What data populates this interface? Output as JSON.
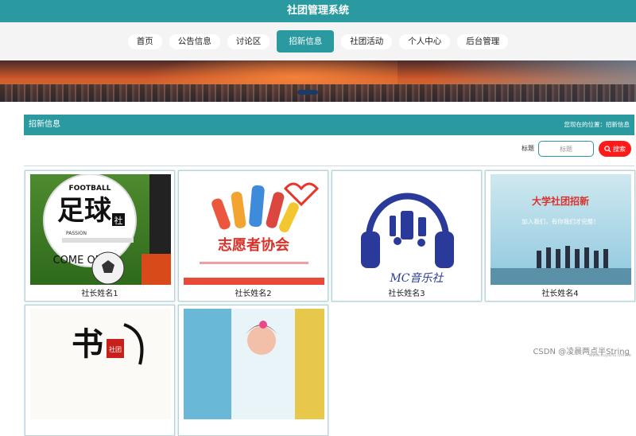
{
  "header": {
    "title": "社团管理系统"
  },
  "nav": {
    "items": [
      {
        "label": "首页"
      },
      {
        "label": "公告信息"
      },
      {
        "label": "讨论区"
      },
      {
        "label": "招新信息"
      },
      {
        "label": "社团活动"
      },
      {
        "label": "个人中心"
      },
      {
        "label": "后台管理"
      }
    ],
    "active_index": 3
  },
  "section": {
    "title": "招新信息",
    "breadcrumb": "您现在的位置：招新信息"
  },
  "search": {
    "label": "标题",
    "placeholder": "标题",
    "button_label": "搜索",
    "icon": "search-icon"
  },
  "cards": [
    {
      "label": "社长姓名1",
      "image_text": [
        "FOOTBALL",
        "足球",
        "社",
        "PASSION",
        "COME ON"
      ]
    },
    {
      "label": "社长姓名2",
      "image_text": [
        "志愿者协会"
      ]
    },
    {
      "label": "社长姓名3",
      "image_text": [
        "MC音乐社"
      ]
    },
    {
      "label": "社长姓名4",
      "image_text": [
        "大学社团招新",
        "加入我们，有你我们才完整！"
      ]
    },
    {
      "label": "",
      "image_text": [
        "书",
        "社团"
      ]
    },
    {
      "label": "",
      "image_text": []
    }
  ],
  "watermark": {
    "text": "CSDN @凌晨两点半String",
    "subtext": "www.kuyahu.online"
  },
  "colors": {
    "primary": "#2a9aa0",
    "search_button": "#ff1a1a"
  }
}
